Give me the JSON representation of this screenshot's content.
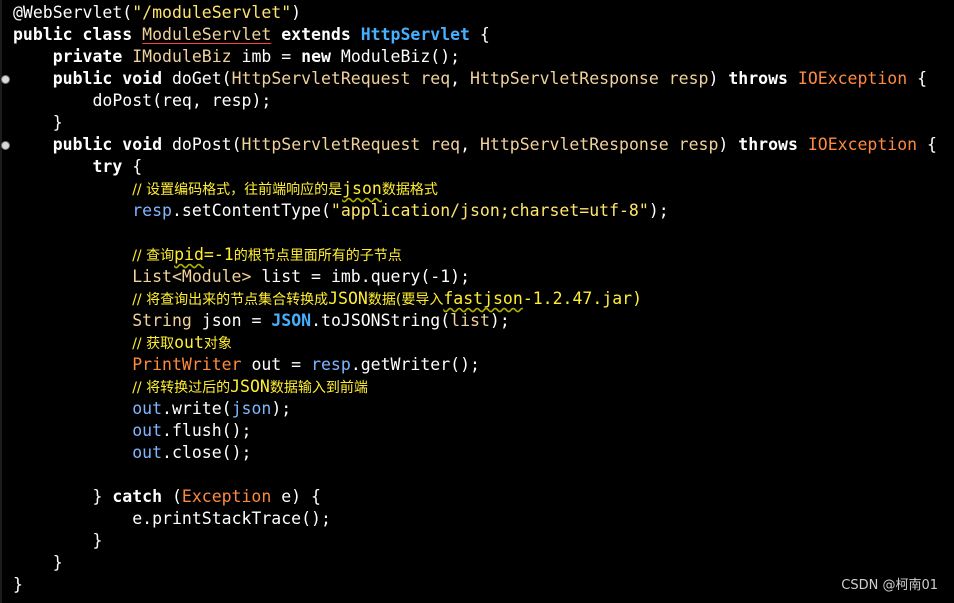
{
  "code": {
    "annotation": "@WebServlet",
    "annotation_value": "\"/moduleServlet\"",
    "kw_public": "public",
    "kw_class": "class",
    "kw_extends": "extends",
    "kw_private": "private",
    "kw_new": "new",
    "kw_void": "void",
    "kw_throws": "throws",
    "kw_try": "try",
    "kw_catch": "catch",
    "class_name": "ModuleServlet",
    "super_class": "HttpServlet",
    "field_type": "IModuleBiz",
    "field_name": "imb",
    "field_init": "ModuleBiz",
    "method_get": "doGet",
    "method_post": "doPost",
    "req_type": "HttpServletRequest",
    "req_name": "req",
    "resp_type": "HttpServletResponse",
    "resp_name": "resp",
    "io_exception": "IOException",
    "comment1_a": "// 设置编码格式，往前端响应的是",
    "comment1_b": "json",
    "comment1_c": "数据格式",
    "set_content_type": "setContentType",
    "content_type_value": "\"application/json;charset=utf-8\"",
    "comment2_a": "// 查询",
    "comment2_b": "pid",
    "comment2_c": "=-1",
    "comment2_d": "的根节点里面所有的子节点",
    "list_type": "List<Module>",
    "list_var": "list",
    "query_method": "query",
    "query_arg": "-1",
    "comment3_a": "// 将查询出来的节点集合转换成",
    "comment3_b": "JSON",
    "comment3_c": "数据(要导入",
    "comment3_d": "fastjson",
    "comment3_e": "-1.2.47.jar)",
    "string_type": "String",
    "json_var": "json",
    "json_class": "JSON",
    "to_json_method": "toJSONString",
    "comment4_a": "// 获取",
    "comment4_b": "out",
    "comment4_c": "对象",
    "printwriter_type": "PrintWriter",
    "out_var": "out",
    "get_writer": "getWriter",
    "comment5_a": "// 将转换过后的",
    "comment5_b": "JSON",
    "comment5_c": "数据输入到前端",
    "write_method": "write",
    "flush_method": "flush",
    "close_method": "close",
    "exception_type": "Exception",
    "exception_var": "e",
    "print_stack_trace": "printStackTrace"
  },
  "watermark": "CSDN @柯南01"
}
